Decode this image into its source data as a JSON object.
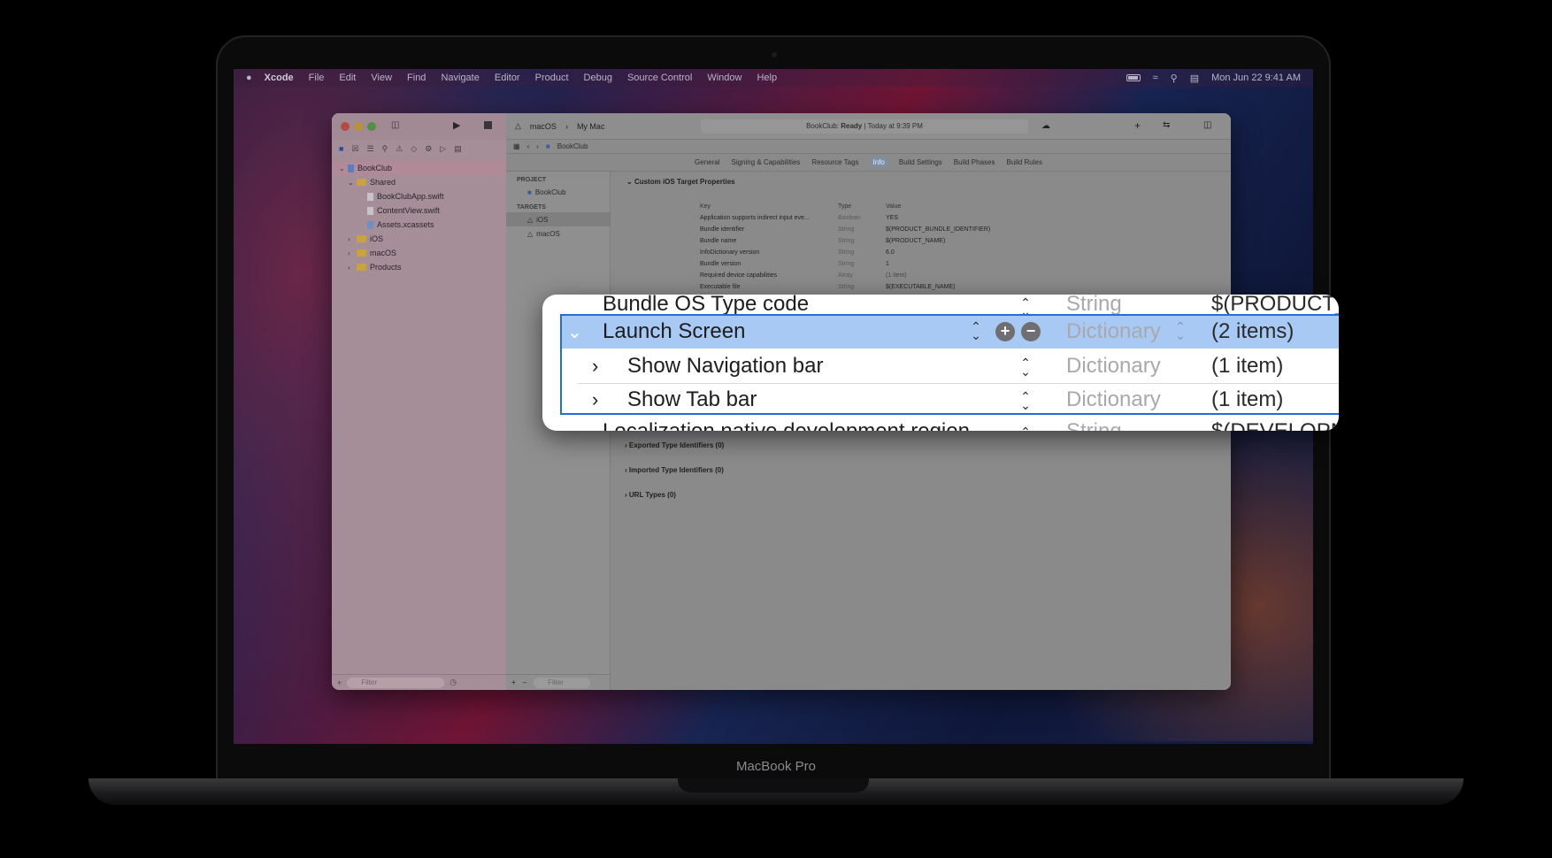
{
  "menubar": {
    "items": [
      "Xcode",
      "File",
      "Edit",
      "View",
      "Find",
      "Navigate",
      "Editor",
      "Product",
      "Debug",
      "Source Control",
      "Window",
      "Help"
    ],
    "clock": "Mon Jun 22  9:41 AM"
  },
  "toolbar": {
    "scheme": "macOS",
    "destination": "My Mac",
    "status_prefix": "BookClub: ",
    "status_bold": "Ready",
    "status_suffix": " | Today at 9:39 PM"
  },
  "navigator": {
    "project": "BookClub",
    "shared": "Shared",
    "files": [
      "BookClubApp.swift",
      "ContentView.swift",
      "Assets.xcassets"
    ],
    "folders": [
      "iOS",
      "macOS",
      "Products"
    ],
    "filter_placeholder": "Filter"
  },
  "jumpbar": {
    "crumb": "BookClub"
  },
  "tabs": [
    "General",
    "Signing & Capabilities",
    "Resource Tags",
    "Info",
    "Build Settings",
    "Build Phases",
    "Build Rules"
  ],
  "active_tab": "Info",
  "targets_panel": {
    "project_header": "PROJECT",
    "project_item": "BookClub",
    "targets_header": "TARGETS",
    "targets": [
      "iOS",
      "macOS"
    ],
    "filter_placeholder": "Filter"
  },
  "info": {
    "section_title": "Custom iOS Target Properties",
    "columns": {
      "key": "Key",
      "type": "Type",
      "value": "Value"
    },
    "rows": [
      {
        "key": "Application supports indirect input eve...",
        "type": "Boolean",
        "value": "YES"
      },
      {
        "key": "Bundle identifier",
        "type": "String",
        "value": "$(PRODUCT_BUNDLE_IDENTIFIER)"
      },
      {
        "key": "Bundle name",
        "type": "String",
        "value": "$(PRODUCT_NAME)"
      },
      {
        "key": "InfoDictionary version",
        "type": "String",
        "value": "6.0"
      },
      {
        "key": "Bundle version",
        "type": "String",
        "value": "1"
      },
      {
        "key": "Required device capabilities",
        "type": "Array",
        "value": "(1 item)"
      },
      {
        "key": "Executable file",
        "type": "String",
        "value": "$(EXECUTABLE_NAME)"
      }
    ],
    "sections": [
      "Exported Type Identifiers (0)",
      "Imported Type Identifiers (0)",
      "URL Types (0)"
    ]
  },
  "callout": {
    "top_partial": {
      "key": "Bundle OS Type code",
      "type": "String",
      "value": "$(PRODUCT_"
    },
    "launch_screen": {
      "key": "Launch Screen",
      "type": "Dictionary",
      "value": "(2 items)"
    },
    "children": [
      {
        "key": "Show Navigation bar",
        "type": "Dictionary",
        "value": "(1 item)"
      },
      {
        "key": "Show Tab bar",
        "type": "Dictionary",
        "value": "(1 item)"
      }
    ],
    "bottom_partial": {
      "key": "Localization native development region",
      "type": "String",
      "value": "$(DEVELOPM"
    }
  },
  "device_label": "MacBook Pro",
  "colors": {
    "selection": "#a9c9f5",
    "selection_border": "#1f6fe0",
    "info_tab": "#7b8fa7"
  }
}
